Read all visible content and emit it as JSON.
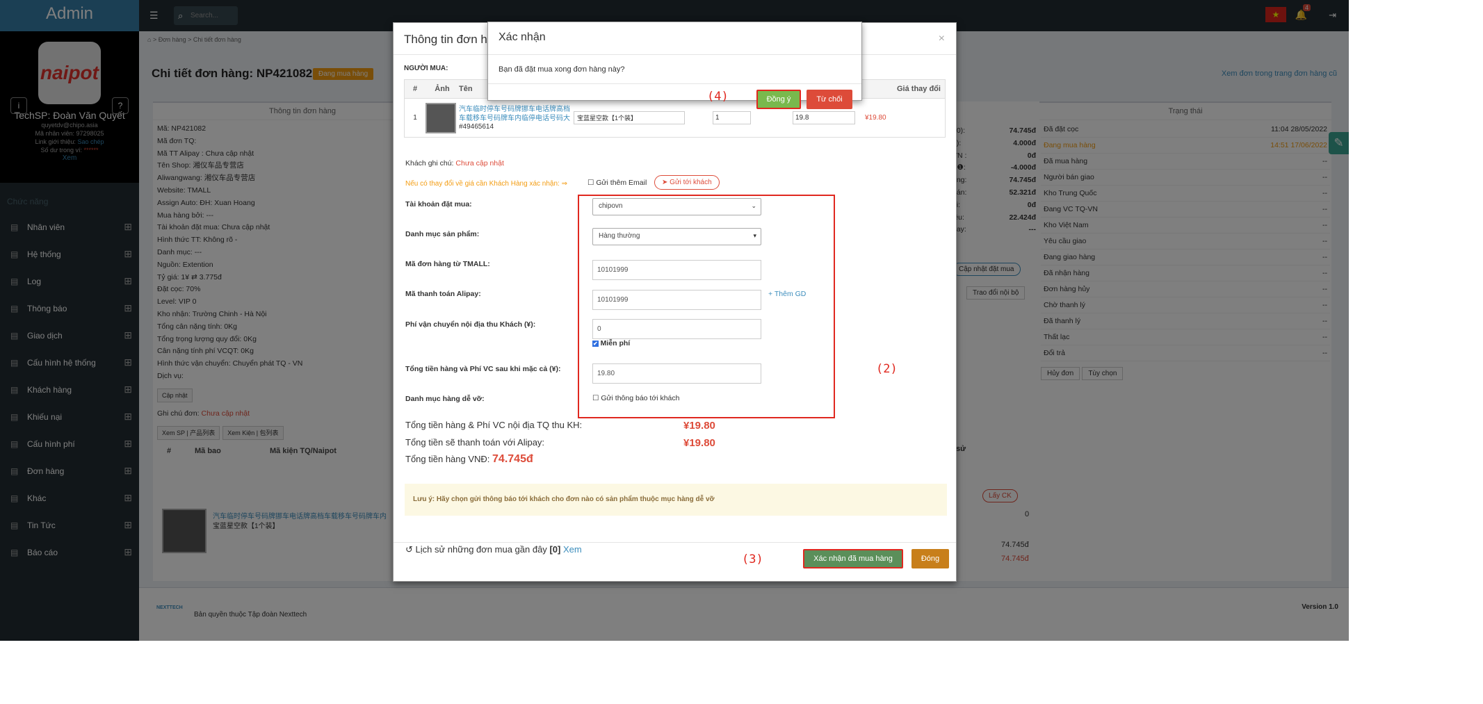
{
  "sidebar": {
    "brand": "Admin",
    "logo_text": "naipot",
    "info_btn": "i",
    "help_btn": "?",
    "user_name": "TechSP: Đoàn Văn Quyết",
    "email": "quyetdv@chipo.asia",
    "staff_id": "Mã nhân viên: 97298025",
    "ref_label": "Link giới thiệu:",
    "ref_copy": "Sao chép",
    "balance_label": "Số dư trong ví:",
    "balance_value": "******",
    "view": "Xem",
    "section": "Chức năng",
    "items": [
      "Nhân viên",
      "Hệ thống",
      "Log",
      "Thông báo",
      "Giao dịch",
      "Cấu hình hệ thống",
      "Khách hàng",
      "Khiếu nại",
      "Cấu hình phí",
      "Đơn hàng",
      "Khác",
      "Tin Tức",
      "Báo cáo"
    ]
  },
  "topbar": {
    "search_placeholder": "Search...",
    "notif_count": "4"
  },
  "breadcrumb": {
    "home": "⌂",
    "order": "Đơn hàng",
    "detail": "Chi tiết đơn hàng"
  },
  "page": {
    "title": "Chi tiết đơn hàng: NP421082",
    "status": "Đang mua hàng",
    "old_link": "Xem đơn trong trang đơn hàng cũ"
  },
  "left_box": {
    "title": "Thông tin đơn hàng",
    "lines": [
      "Mã: NP421082",
      "Mã đơn TQ:",
      "Mã TT Alipay : Chưa cập nhật",
      "Tên Shop: 湘仪车品专营店",
      "Aliwangwang: 湘仪车品专营店",
      "Website: TMALL",
      "Assign Auto: ĐH: Xuan Hoang",
      "Mua hàng bởi: ---",
      "Tài khoản đặt mua: Chưa cập nhật",
      "Hình thức TT: Không rõ -",
      "Danh mục: ---",
      "Nguồn: Extention",
      "Tỷ giá: 1¥ ⇄ 3.775đ",
      "Đặt cọc: 70%",
      "Level: VIP 0",
      "Kho nhận: Trường Chinh - Hà Nội",
      "Tổng cân nặng tính: 0Kg",
      "Tổng trọng lượng quy đổi: 0Kg",
      "Cân nặng tính phí VCQT: 0Kg",
      "Hình thức vận chuyển: Chuyển phát TQ - VN",
      "Dịch vụ:"
    ],
    "update_btn": "Cập nhật",
    "note_label": "Ghi chú đơn:",
    "note_value": "Chưa cập nhật",
    "btn1": "Xem SP | 产品列表",
    "btn2": "Xem Kiện | 包列表",
    "col_hash": "#",
    "col_package": "Mã bao",
    "col_naipot": "Mã kiện TQ/Naipot",
    "product_name": "汽车临时停车号码牌挪车电话牌高档车载移车号码牌车内",
    "product_variant": "宝蓝星空款【1个装】"
  },
  "mid": {
    "lines": [
      "80):",
      "đ):",
      "VN :",
      ") ❶:",
      "àng:",
      "oán:",
      "ại:",
      "iều:",
      "pay:"
    ],
    "vals": [
      "74.745đ",
      "4.000đ",
      "0đ",
      "-4.000đ",
      "74.745đ",
      "52.321đ",
      "0đ",
      "22.424đ",
      "---"
    ],
    "update_btn": "Cập nhật đặt mua",
    "internal_btn": "Trao đổi nội bộ",
    "get_ck": "Lấy CK",
    "zero": "0",
    "sum1": "74.745đ",
    "sum2": "74.745đ",
    "col_su": "sử"
  },
  "status_box": {
    "title": "Trạng thái",
    "rows": [
      [
        "Đã đặt cọc",
        "11:04 28/05/2022"
      ],
      [
        "Đang mua hàng",
        "14:51 17/06/2022"
      ],
      [
        "Đã mua hàng",
        "--"
      ],
      [
        "Người bán giao",
        "--"
      ],
      [
        "Kho Trung Quốc",
        "--"
      ],
      [
        "Đang VC TQ-VN",
        "--"
      ],
      [
        "Kho Việt Nam",
        "--"
      ],
      [
        "Yêu cầu giao",
        "--"
      ],
      [
        "Đang giao hàng",
        "--"
      ],
      [
        "Đã nhận hàng",
        "--"
      ],
      [
        "Đơn hàng hủy",
        "--"
      ],
      [
        "Chờ thanh lý",
        "--"
      ],
      [
        "Đã thanh lý",
        "--"
      ],
      [
        "Thất lạc",
        "--"
      ],
      [
        "Đổi trả",
        "--"
      ]
    ],
    "cancel_btn": "Hủy đơn",
    "options_btn": "Tùy chọn"
  },
  "modal": {
    "title": "Thông tin đơn hàng",
    "buyer_label": "NGƯỜI MUA:",
    "cols": [
      "#",
      "Ảnh",
      "Tên",
      "",
      "Giá thay đổi"
    ],
    "row_no": "1",
    "product_name": "汽车临时停车号码牌挪车电话牌高档车载移车号码牌车内临停电话号码大全",
    "product_id": "#49465614",
    "variant": "宝蓝星空款【1个装】",
    "qty": "1",
    "price_input": "19.8",
    "price_change": "¥19.80",
    "cust_note_label": "Khách ghi chú:",
    "cust_note_value": "Chưa cập nhật",
    "warn": "Nếu có thay đổi về giá cần Khách Hàng xác nhận: ⇒",
    "send_email": "Gửi thêm Email",
    "send_customer": "Gửi tới khách",
    "f_account": "Tài khoản đặt mua:",
    "v_account": "chipovn",
    "f_category": "Danh mục sản phẩm:",
    "v_category": "Hàng thường",
    "f_tmall": "Mã đơn hàng từ TMALL:",
    "v_tmall": "10101999",
    "f_alipay": "Mã thanh toán Alipay:",
    "v_alipay": "10101999",
    "add_gd": "+ Thêm GD",
    "f_ship": "Phí vận chuyển nội địa thu Khách (¥):",
    "v_ship": "0",
    "free": "Miễn phí",
    "f_total": "Tổng tiền hàng và Phí VC sau khi mặc cả (¥):",
    "v_total": "19.80",
    "f_fragile": "Danh mục hàng dễ vỡ:",
    "notify": "Gửi thông báo tới khách",
    "sum1_label": "Tổng tiền hàng & Phí VC nội địa TQ thu KH:",
    "sum1_value": "¥19.80",
    "sum2_label": "Tổng tiền sẽ thanh toán với Alipay:",
    "sum2_value": "¥19.80",
    "sum3_label": "Tổng tiền hàng VNĐ:",
    "sum3_value": "74.745đ",
    "note": "Lưu ý: Hãy chọn gửi thông báo tới khách cho đơn nào có sản phẩm thuộc mục hàng dễ vỡ",
    "history": "Lịch sử những đơn mua gần đây",
    "history_count": "[0]",
    "history_view": "Xem",
    "confirm_btn": "Xác nhận đã mua hàng",
    "close_btn": "Đóng"
  },
  "confirm": {
    "title": "Xác nhận",
    "message": "Bạn đã đặt mua xong đơn hàng này?",
    "ok": "Đồng ý",
    "reject": "Từ chối"
  },
  "annotations": {
    "a2": "(2)",
    "a3": "(3)",
    "a4": "(4)"
  },
  "footer": {
    "copyright": "Bản quyền thuộc Tập đoàn Nexttech",
    "version": "Version 1.0",
    "logo": "NEXTTECH"
  },
  "colors": {
    "accent": "#3c8dbc",
    "danger": "#dd4b39",
    "warning": "#f39c12",
    "success": "#00a65a",
    "annotation": "#e0281f"
  }
}
